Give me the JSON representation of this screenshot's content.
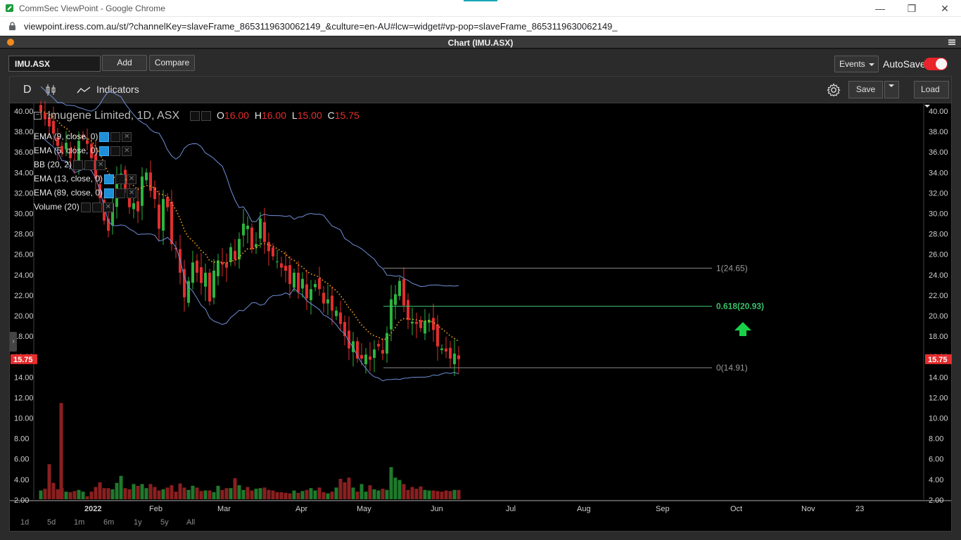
{
  "window": {
    "title": "CommSec ViewPoint - Google Chrome",
    "url": "viewpoint.iress.com.au/st/?channelKey=slaveFrame_8653119630062149_&culture=en-AU#lcw=widget#vp-pop=slaveFrame_8653119630062149_",
    "minimize": "—",
    "restore": "❐",
    "close": "✕"
  },
  "panel": {
    "title": "Chart (IMU.ASX)"
  },
  "toolbar": {
    "symbol": "IMU.ASX",
    "add_label": "Add",
    "compare_label": "Compare",
    "events_label": "Events",
    "autosave_label": "AutoSave",
    "autosave_on": true
  },
  "chart_toolbar": {
    "interval": "D",
    "indicators_label": "Indicators",
    "save_label": "Save",
    "load_label": "Load"
  },
  "legend": {
    "collapse_glyph": "−",
    "title": "Imugene Limited, 1D, ASX",
    "open_key": "O",
    "open": "16.00",
    "high_key": "H",
    "high": "16.00",
    "low_key": "L",
    "low": "15.00",
    "close_key": "C",
    "close": "15.75",
    "indicators": [
      {
        "label": "EMA (9, close, 0)",
        "active": true
      },
      {
        "label": "EMA (5, close, 0)",
        "active": true
      },
      {
        "label": "BB (20, 2)",
        "active": false
      },
      {
        "label": "EMA (13, close, 0)",
        "active": true
      },
      {
        "label": "EMA (89, close, 0)",
        "active": true
      },
      {
        "label": "Volume (20)",
        "active": false
      }
    ]
  },
  "periods": [
    "1d",
    "5d",
    "1m",
    "6m",
    "1y",
    "5y",
    "All"
  ],
  "colors": {
    "up": "#2db33f",
    "down": "#e02e2e",
    "band": "#6f8fd6",
    "ema": "#f5a623",
    "fib_mid": "#3ac06b",
    "price_badge": "#e52d2d"
  },
  "chart_data": {
    "type": "candlestick",
    "symbol": "IMU.ASX",
    "price_axis": {
      "ticks": [
        "40.00",
        "38.00",
        "36.00",
        "34.00",
        "32.00",
        "30.00",
        "28.00",
        "26.00",
        "24.00",
        "22.00",
        "20.00",
        "18.00",
        "16.00",
        "14.00",
        "12.00",
        "10.00",
        "8.00",
        "6.00",
        "4.00",
        "2.00"
      ],
      "min": 2,
      "max": 40
    },
    "x_axis_labels": [
      "2022",
      "Feb",
      "Mar",
      "Apr",
      "May",
      "Jun",
      "Jul",
      "Aug",
      "Sep",
      "Oct",
      "Nov",
      "23"
    ],
    "last_price": "15.75",
    "fibonacci": [
      {
        "level": 1,
        "label": "1(24.65)",
        "price": 24.65
      },
      {
        "level": 0.618,
        "label": "0.618(20.93)",
        "price": 20.93
      },
      {
        "level": 0,
        "label": "0(14.91)",
        "price": 14.91
      }
    ],
    "closes": [
      40.0,
      39.2,
      38.5,
      37.8,
      36.6,
      35.9,
      36.9,
      35.4,
      35.0,
      37.1,
      37.5,
      36.8,
      35.4,
      33.4,
      31.5,
      29.3,
      28.3,
      31.0,
      33.2,
      33.9,
      32.4,
      30.6,
      31.0,
      30.2,
      33.6,
      34.0,
      32.2,
      31.4,
      28.5,
      31.4,
      30.6,
      27.0,
      26.5,
      24.2,
      21.8,
      23.4,
      25.2,
      24.2,
      23.2,
      24.2,
      21.4,
      24.4,
      25.4,
      25.0,
      24.7,
      26.7,
      25.5,
      27.5,
      29.0,
      28.8,
      26.5,
      27.0,
      29.5,
      27.2,
      26.3,
      25.8,
      25.3,
      24.7,
      24.4,
      23.1,
      24.2,
      22.3,
      23.6,
      21.7,
      22.6,
      23.1,
      22.6,
      21.2,
      21.6,
      20.5,
      20.5,
      19.2,
      18.0,
      16.8,
      17.5,
      15.8,
      15.8,
      16.2,
      15.7,
      16.7,
      17.0,
      16.3,
      18.3,
      21.6,
      22.1,
      23.4,
      21.0,
      19.6,
      19.4,
      19.2,
      18.8,
      19.5,
      19.6,
      18.6,
      17.0,
      16.8,
      16.5,
      15.8,
      16.3,
      15.75
    ],
    "volumes": [
      1.5,
      1.8,
      6.0,
      2.8,
      1.7,
      1.9,
      1.3,
      1.2,
      1.4,
      1.6,
      1.3,
      0.5,
      1.3,
      2.1,
      2.9,
      1.9,
      1.9,
      1.7,
      2.8,
      4.0,
      1.9,
      1.7,
      2.6,
      2.3,
      2.6,
      1.9,
      2.6,
      2.1,
      1.5,
      1.7,
      2.0,
      2.4,
      1.3,
      2.7,
      2.0,
      1.6,
      2.3,
      2.0,
      1.4,
      1.5,
      1.5,
      1.2,
      2.3,
      1.6,
      1.9,
      1.9,
      3.6,
      2.4,
      1.6,
      2.1,
      1.5,
      1.8,
      1.9,
      2.0,
      1.6,
      1.5,
      1.2,
      1.2,
      1.1,
      1.0,
      1.5,
      1.1,
      1.4,
      1.6,
      1.9,
      1.5,
      2.0,
      1.2,
      1.0,
      1.3,
      2.0,
      3.5,
      2.9,
      3.7,
      2.0,
      1.3,
      2.6,
      1.3,
      2.4,
      1.7,
      1.5,
      1.8,
      1.6,
      5.5,
      3.7,
      3.3,
      2.6,
      1.6,
      2.1,
      1.8,
      2.2,
      1.6,
      1.5,
      1.5,
      1.4,
      1.3,
      1.5,
      1.4,
      1.6,
      1.6
    ]
  }
}
